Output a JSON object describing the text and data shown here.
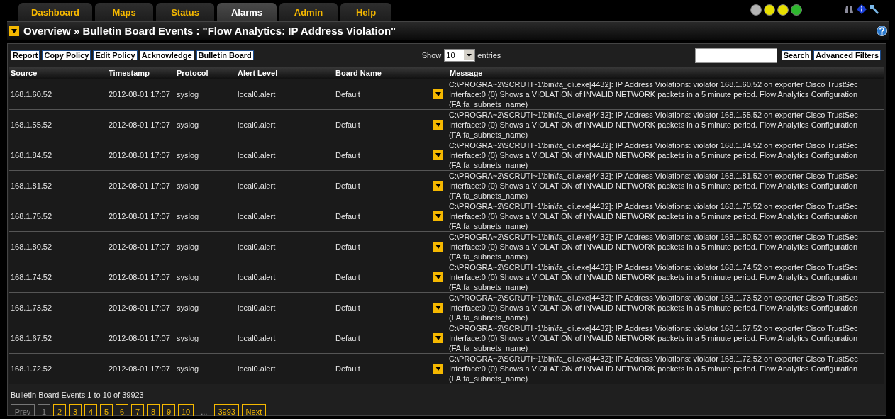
{
  "tabs": [
    {
      "label": "Dashboard",
      "selected": false
    },
    {
      "label": "Maps",
      "selected": false
    },
    {
      "label": "Status",
      "selected": false
    },
    {
      "label": "Alarms",
      "selected": true
    },
    {
      "label": "Admin",
      "selected": false
    },
    {
      "label": "Help",
      "selected": false
    }
  ],
  "status_dots": [
    {
      "color": "#b4b4b4"
    },
    {
      "color": "#e8e000"
    },
    {
      "color": "#e8e000"
    },
    {
      "color": "#2eb82e"
    }
  ],
  "title": "Overview » Bulletin Board Events : \"Flow Analytics: IP Address Violation\"",
  "toolbar_buttons": [
    "Report",
    "Copy Policy",
    "Edit Policy",
    "Acknowledge",
    "Bulletin Board"
  ],
  "show": {
    "label": "Show",
    "value": "10",
    "suffix": "entries"
  },
  "search": {
    "button": "Search"
  },
  "advanced_filters": "Advanced Filters",
  "table": {
    "columns": [
      "Source",
      "Timestamp",
      "Protocol",
      "Alert Level",
      "Board Name",
      "Message"
    ],
    "rows": [
      {
        "source": "168.1.60.52",
        "timestamp": "2012-08-01 17:07",
        "protocol": "syslog",
        "alert_level": "local0.alert",
        "board_name": "Default",
        "message": "C:\\PROGRA~2\\SCRUTI~1\\bin\\fa_cli.exe[4432]: IP Address Violations: violator 168.1.60.52 on exporter Cisco TrustSec Interface:0 (0) Shows a VIOLATION of INVALID NETWORK packets in a 5 minute period. Flow Analytics Configuration (FA:fa_subnets_name)"
      },
      {
        "source": "168.1.55.52",
        "timestamp": "2012-08-01 17:07",
        "protocol": "syslog",
        "alert_level": "local0.alert",
        "board_name": "Default",
        "message": "C:\\PROGRA~2\\SCRUTI~1\\bin\\fa_cli.exe[4432]: IP Address Violations: violator 168.1.55.52 on exporter Cisco TrustSec Interface:0 (0) Shows a VIOLATION of INVALID NETWORK packets in a 5 minute period. Flow Analytics Configuration (FA:fa_subnets_name)"
      },
      {
        "source": "168.1.84.52",
        "timestamp": "2012-08-01 17:07",
        "protocol": "syslog",
        "alert_level": "local0.alert",
        "board_name": "Default",
        "message": "C:\\PROGRA~2\\SCRUTI~1\\bin\\fa_cli.exe[4432]: IP Address Violations: violator 168.1.84.52 on exporter Cisco TrustSec Interface:0 (0) Shows a VIOLATION of INVALID NETWORK packets in a 5 minute period. Flow Analytics Configuration (FA:fa_subnets_name)"
      },
      {
        "source": "168.1.81.52",
        "timestamp": "2012-08-01 17:07",
        "protocol": "syslog",
        "alert_level": "local0.alert",
        "board_name": "Default",
        "message": "C:\\PROGRA~2\\SCRUTI~1\\bin\\fa_cli.exe[4432]: IP Address Violations: violator 168.1.81.52 on exporter Cisco TrustSec Interface:0 (0) Shows a VIOLATION of INVALID NETWORK packets in a 5 minute period. Flow Analytics Configuration (FA:fa_subnets_name)"
      },
      {
        "source": "168.1.75.52",
        "timestamp": "2012-08-01 17:07",
        "protocol": "syslog",
        "alert_level": "local0.alert",
        "board_name": "Default",
        "message": "C:\\PROGRA~2\\SCRUTI~1\\bin\\fa_cli.exe[4432]: IP Address Violations: violator 168.1.75.52 on exporter Cisco TrustSec Interface:0 (0) Shows a VIOLATION of INVALID NETWORK packets in a 5 minute period. Flow Analytics Configuration (FA:fa_subnets_name)"
      },
      {
        "source": "168.1.80.52",
        "timestamp": "2012-08-01 17:07",
        "protocol": "syslog",
        "alert_level": "local0.alert",
        "board_name": "Default",
        "message": "C:\\PROGRA~2\\SCRUTI~1\\bin\\fa_cli.exe[4432]: IP Address Violations: violator 168.1.80.52 on exporter Cisco TrustSec Interface:0 (0) Shows a VIOLATION of INVALID NETWORK packets in a 5 minute period. Flow Analytics Configuration (FA:fa_subnets_name)"
      },
      {
        "source": "168.1.74.52",
        "timestamp": "2012-08-01 17:07",
        "protocol": "syslog",
        "alert_level": "local0.alert",
        "board_name": "Default",
        "message": "C:\\PROGRA~2\\SCRUTI~1\\bin\\fa_cli.exe[4432]: IP Address Violations: violator 168.1.74.52 on exporter Cisco TrustSec Interface:0 (0) Shows a VIOLATION of INVALID NETWORK packets in a 5 minute period. Flow Analytics Configuration (FA:fa_subnets_name)"
      },
      {
        "source": "168.1.73.52",
        "timestamp": "2012-08-01 17:07",
        "protocol": "syslog",
        "alert_level": "local0.alert",
        "board_name": "Default",
        "message": "C:\\PROGRA~2\\SCRUTI~1\\bin\\fa_cli.exe[4432]: IP Address Violations: violator 168.1.73.52 on exporter Cisco TrustSec Interface:0 (0) Shows a VIOLATION of INVALID NETWORK packets in a 5 minute period. Flow Analytics Configuration (FA:fa_subnets_name)"
      },
      {
        "source": "168.1.67.52",
        "timestamp": "2012-08-01 17:07",
        "protocol": "syslog",
        "alert_level": "local0.alert",
        "board_name": "Default",
        "message": "C:\\PROGRA~2\\SCRUTI~1\\bin\\fa_cli.exe[4432]: IP Address Violations: violator 168.1.67.52 on exporter Cisco TrustSec Interface:0 (0) Shows a VIOLATION of INVALID NETWORK packets in a 5 minute period. Flow Analytics Configuration (FA:fa_subnets_name)"
      },
      {
        "source": "168.1.72.52",
        "timestamp": "2012-08-01 17:07",
        "protocol": "syslog",
        "alert_level": "local0.alert",
        "board_name": "Default",
        "message": "C:\\PROGRA~2\\SCRUTI~1\\bin\\fa_cli.exe[4432]: IP Address Violations: violator 168.1.72.52 on exporter Cisco TrustSec Interface:0 (0) Shows a VIOLATION of INVALID NETWORK packets in a 5 minute period. Flow Analytics Configuration (FA:fa_subnets_name)"
      }
    ]
  },
  "summary": "Bulletin Board Events 1 to 10 of 39923",
  "pagination": {
    "prev": {
      "label": "Prev",
      "disabled": true
    },
    "pages": [
      {
        "label": "1",
        "selected": true
      },
      {
        "label": "2",
        "selected": false
      },
      {
        "label": "3",
        "selected": false
      },
      {
        "label": "4",
        "selected": false
      },
      {
        "label": "5",
        "selected": false
      },
      {
        "label": "6",
        "selected": false
      },
      {
        "label": "7",
        "selected": false
      },
      {
        "label": "8",
        "selected": false
      },
      {
        "label": "9",
        "selected": false
      },
      {
        "label": "10",
        "selected": false
      }
    ],
    "ellipsis": "...",
    "last": {
      "label": "3993",
      "selected": false
    },
    "next": {
      "label": "Next",
      "disabled": false
    }
  }
}
